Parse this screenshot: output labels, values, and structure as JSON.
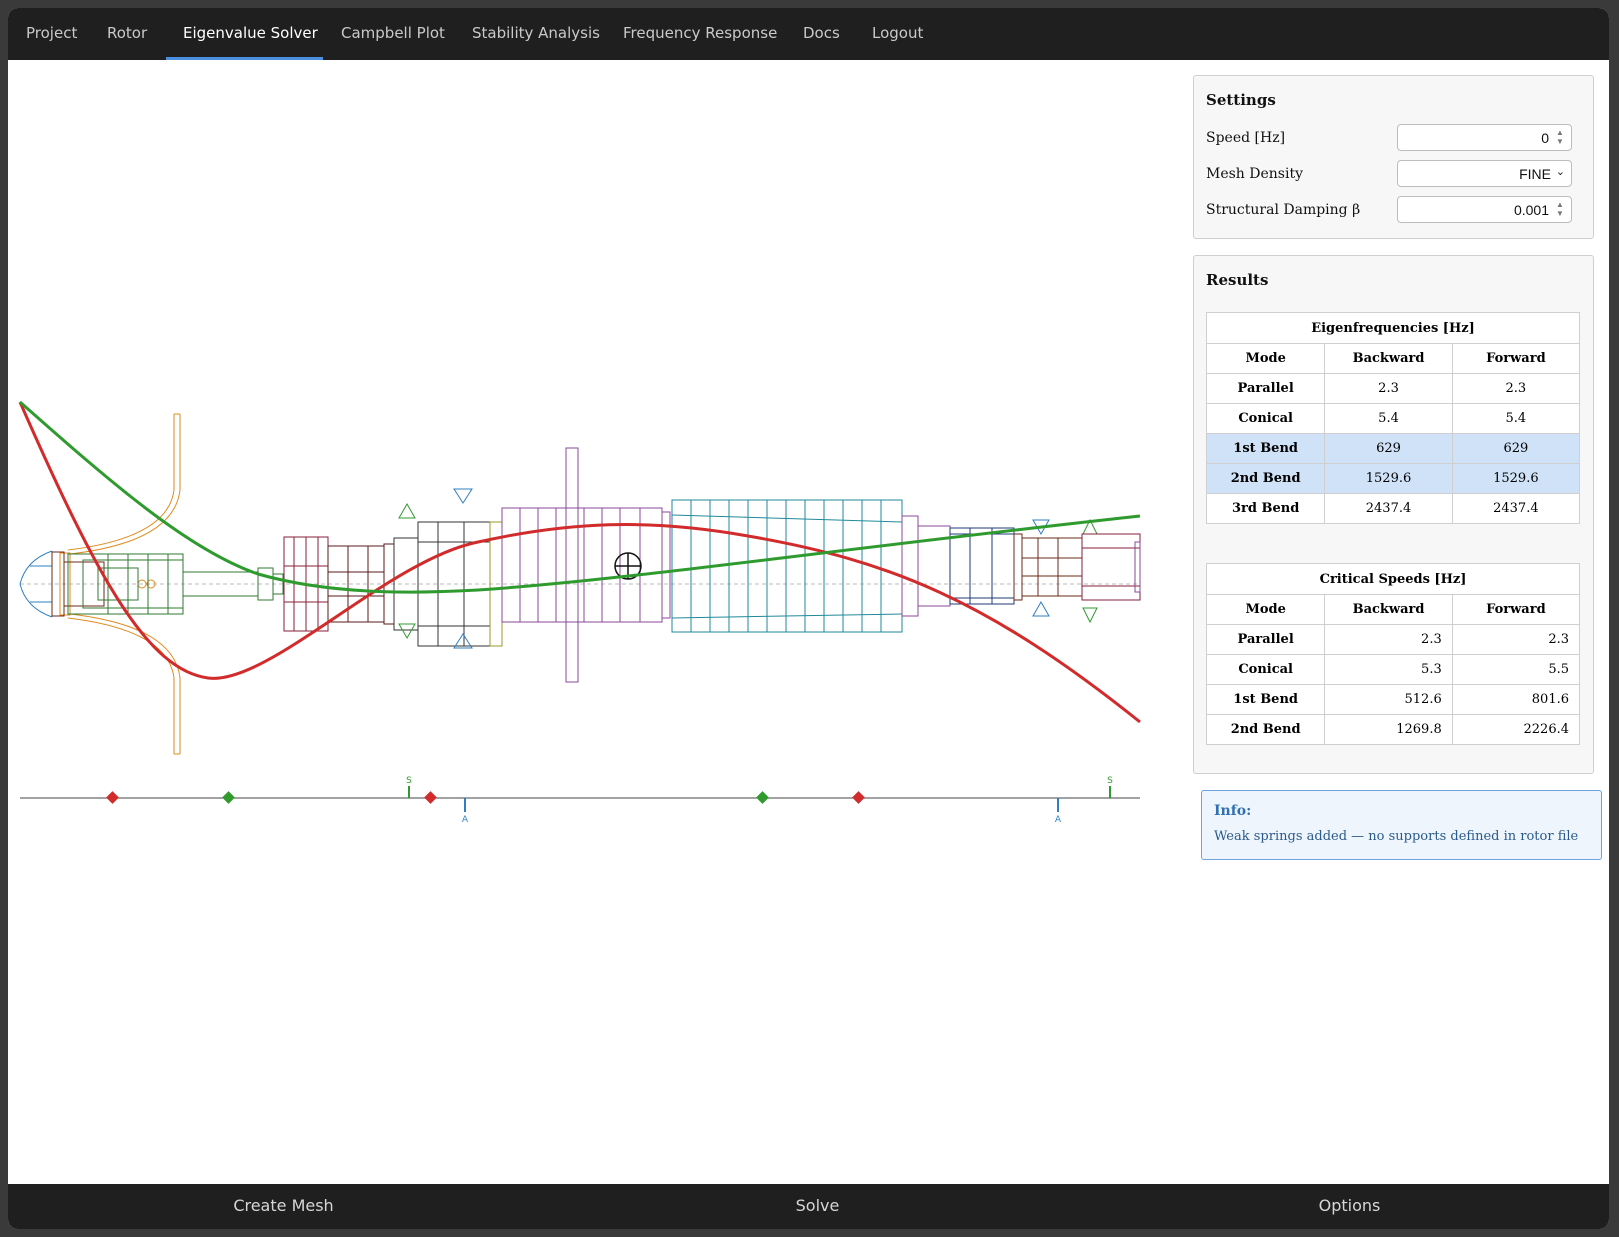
{
  "tabs": [
    {
      "label": "Project"
    },
    {
      "label": "Rotor"
    },
    {
      "label": "Eigenvalue Solver"
    },
    {
      "label": "Campbell Plot"
    },
    {
      "label": "Stability Analysis"
    },
    {
      "label": "Frequency Response"
    },
    {
      "label": "Docs"
    },
    {
      "label": "Logout"
    }
  ],
  "active_tab": "Eigenvalue Solver",
  "settings": {
    "title": "Settings",
    "speed_label": "Speed [Hz]",
    "speed_value": "0",
    "mesh_label": "Mesh Density",
    "mesh_value": "FINE",
    "damping_label": "Structural Damping β",
    "damping_value": "0.001"
  },
  "results": {
    "title": "Results",
    "eigen": {
      "caption": "Eigenfrequencies [Hz]",
      "headers": [
        "Mode",
        "Backward",
        "Forward"
      ],
      "rows": [
        {
          "mode": "Parallel",
          "backward": "2.3",
          "forward": "2.3"
        },
        {
          "mode": "Conical",
          "backward": "5.4",
          "forward": "5.4"
        },
        {
          "mode": "1st Bend",
          "backward": "629",
          "forward": "629"
        },
        {
          "mode": "2nd Bend",
          "backward": "1529.6",
          "forward": "1529.6"
        },
        {
          "mode": "3rd Bend",
          "backward": "2437.4",
          "forward": "2437.4"
        }
      ]
    },
    "critical": {
      "caption": "Critical Speeds [Hz]",
      "headers": [
        "Mode",
        "Backward",
        "Forward"
      ],
      "rows": [
        {
          "mode": "Parallel",
          "backward": "2.3",
          "forward": "2.3"
        },
        {
          "mode": "Conical",
          "backward": "5.3",
          "forward": "5.5"
        },
        {
          "mode": "1st Bend",
          "backward": "512.6",
          "forward": "801.6"
        },
        {
          "mode": "2nd Bend",
          "backward": "1269.8",
          "forward": "2226.4"
        }
      ]
    }
  },
  "info": {
    "title": "Info:",
    "text": "Weak springs added — no supports defined in rotor file"
  },
  "axis_markers": {
    "s_label": "S",
    "a_label": "A"
  },
  "bottom": {
    "create_mesh": "Create Mesh",
    "solve": "Solve",
    "options": "Options"
  },
  "colors": {
    "mode_red": "#d12b2b",
    "mode_green": "#2f9b2f",
    "bearing_blue": "#2f7fc1",
    "accent": "#4a8fe0"
  }
}
